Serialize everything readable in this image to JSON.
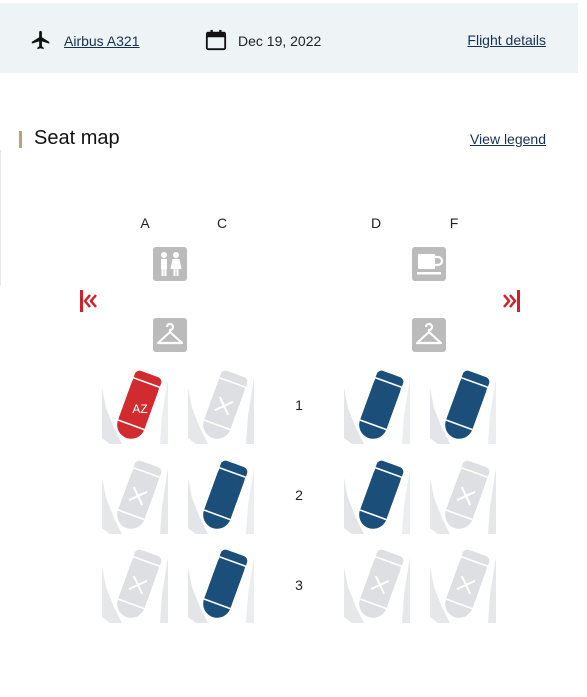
{
  "header": {
    "aircraft_label": "Airbus A321",
    "date_label": "Dec 19, 2022",
    "details_link": "Flight details",
    "plane_icon": "airplane-icon",
    "calendar_icon": "calendar-icon"
  },
  "seat_map": {
    "title": "Seat map",
    "legend_link": "View legend",
    "columns": [
      "A",
      "C",
      "D",
      "F"
    ],
    "facilities": {
      "left": [
        "lavatory-icon",
        "hanger-icon"
      ],
      "right": [
        "coffee-cup-icon",
        "hanger-icon"
      ]
    },
    "exits": {
      "left": "exit-left-icon",
      "right": "exit-right-icon"
    },
    "rows": [
      {
        "number": "1",
        "seats": [
          {
            "column": "A",
            "status": "selected",
            "label": "AZ"
          },
          {
            "column": "C",
            "status": "unavailable",
            "label": ""
          },
          {
            "column": "D",
            "status": "available",
            "label": ""
          },
          {
            "column": "F",
            "status": "available",
            "label": ""
          }
        ]
      },
      {
        "number": "2",
        "seats": [
          {
            "column": "A",
            "status": "unavailable",
            "label": ""
          },
          {
            "column": "C",
            "status": "available",
            "label": ""
          },
          {
            "column": "D",
            "status": "available",
            "label": ""
          },
          {
            "column": "F",
            "status": "unavailable",
            "label": ""
          }
        ]
      },
      {
        "number": "3",
        "seats": [
          {
            "column": "A",
            "status": "unavailable",
            "label": ""
          },
          {
            "column": "C",
            "status": "available",
            "label": ""
          },
          {
            "column": "D",
            "status": "unavailable",
            "label": ""
          },
          {
            "column": "F",
            "status": "unavailable",
            "label": ""
          }
        ]
      }
    ]
  },
  "colors": {
    "available": "#1b4f7a",
    "selected": "#d12a2f",
    "unavailable": "#dddfe2",
    "facility": "#bbbbbb",
    "exit": "#d0202c",
    "link": "#16304f",
    "accent_bar": "#b7a383",
    "header_bg": "#eef3f6"
  }
}
